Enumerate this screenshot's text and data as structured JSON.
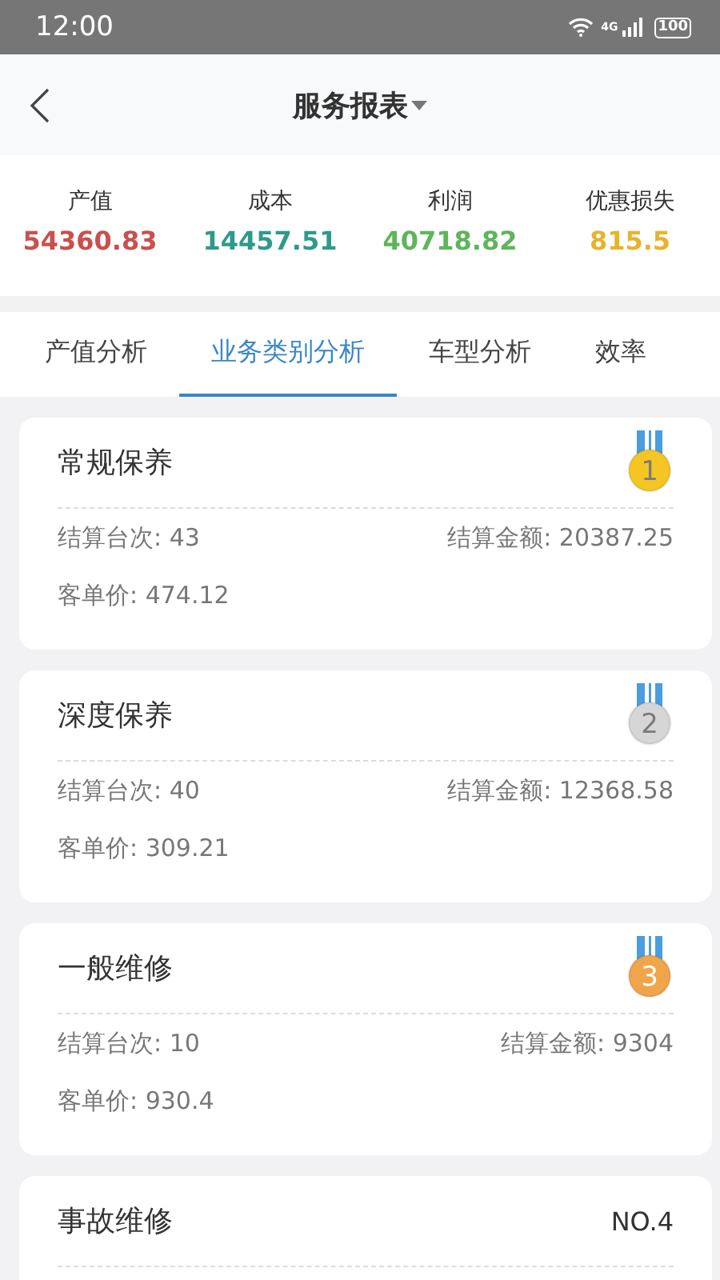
{
  "status_bar": {
    "time": "12:00",
    "network": "4G",
    "battery": "100"
  },
  "header": {
    "title": "服务报表"
  },
  "summary": [
    {
      "label": "产值",
      "value": "54360.83",
      "color": "#c9504e"
    },
    {
      "label": "成本",
      "value": "14457.51",
      "color": "#2e9a8a"
    },
    {
      "label": "利润",
      "value": "40718.82",
      "color": "#5fb55a"
    },
    {
      "label": "优惠损失",
      "value": "815.5",
      "color": "#e6b32a"
    }
  ],
  "tabs": [
    {
      "label": "产值分析",
      "selected": false
    },
    {
      "label": "业务类别分析",
      "selected": true
    },
    {
      "label": "车型分析",
      "selected": false
    },
    {
      "label": "效率",
      "selected": false
    }
  ],
  "cards": [
    {
      "title": "常规保养",
      "rank": {
        "kind": "medal",
        "text": "1",
        "color": "#f5c623"
      },
      "count": "结算台次: 43",
      "amount": "结算金额: 20387.25",
      "unit_price": "客单价: 474.12"
    },
    {
      "title": "深度保养",
      "rank": {
        "kind": "medal",
        "text": "2",
        "color": "#d6d6d6"
      },
      "count": "结算台次: 40",
      "amount": "结算金额: 12368.58",
      "unit_price": "客单价: 309.21"
    },
    {
      "title": "一般维修",
      "rank": {
        "kind": "medal",
        "text": "3",
        "color": "#f0a54a"
      },
      "count": "结算台次: 10",
      "amount": "结算金额: 9304",
      "unit_price": "客单价: 930.4"
    },
    {
      "title": "事故维修",
      "rank": {
        "kind": "label",
        "text": "NO.4"
      }
    }
  ]
}
